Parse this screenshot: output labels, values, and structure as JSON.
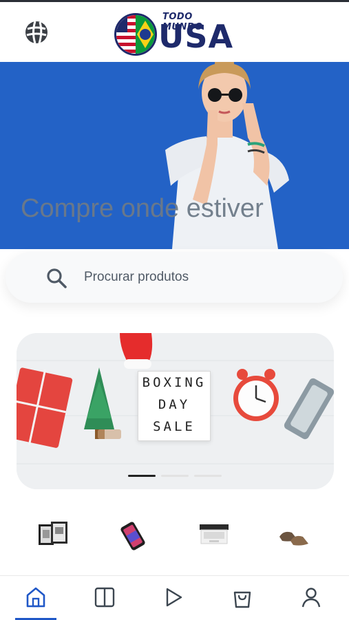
{
  "header": {
    "globe_icon": "globe-icon",
    "logo": {
      "top_text": "TODO MUNDO",
      "main_text": "USA"
    }
  },
  "hero": {
    "headline": "Compre onde estiver"
  },
  "search": {
    "placeholder": "Procurar produtos",
    "icon": "search-icon"
  },
  "banner": {
    "letterboard_lines": [
      "BOXING",
      "DAY",
      "SALE"
    ],
    "slides_count": 3,
    "active_slide": 1
  },
  "categories": [
    {
      "icon": "picture-frames-icon"
    },
    {
      "icon": "smartphone-icon"
    },
    {
      "icon": "laptop-icon"
    },
    {
      "icon": "shoes-icon"
    }
  ],
  "tabbar": {
    "tabs": [
      {
        "icon": "home-icon",
        "active": true
      },
      {
        "icon": "catalog-icon",
        "active": false
      },
      {
        "icon": "play-icon",
        "active": false
      },
      {
        "icon": "bag-icon",
        "active": false
      },
      {
        "icon": "user-icon",
        "active": false
      }
    ]
  },
  "colors": {
    "brand": "#1e2a6b",
    "accent": "#1f57c7",
    "hero_bg": "#1f5fc4"
  }
}
